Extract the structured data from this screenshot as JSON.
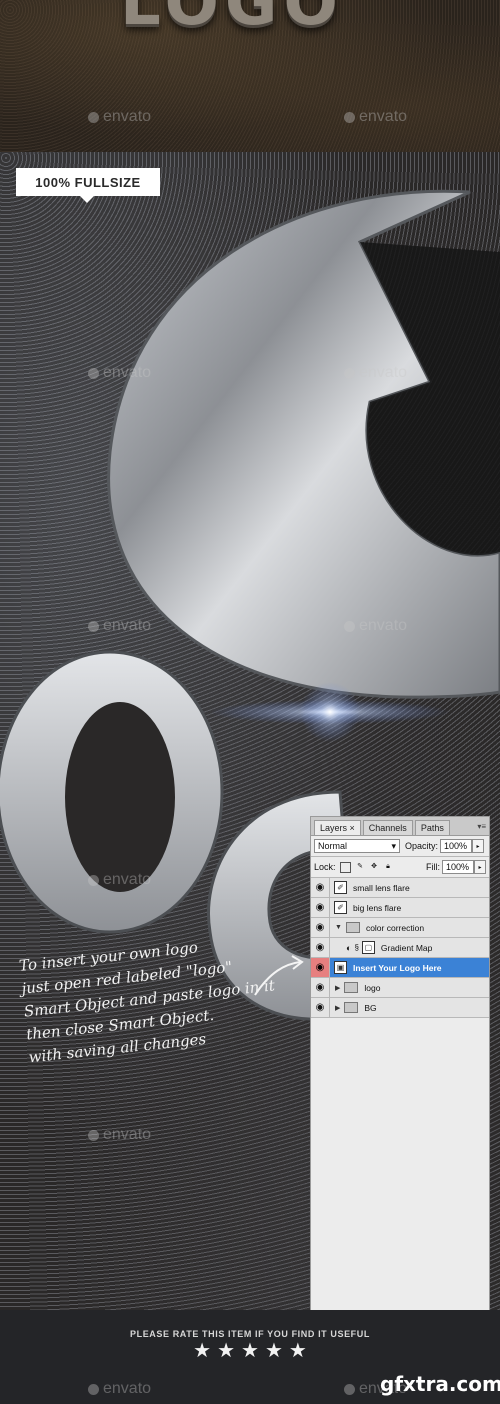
{
  "top_banner": {
    "logo_text": "LOGO",
    "watermark_left": "envato",
    "watermark_right": "envato"
  },
  "badge": {
    "label": "100% FULLSIZE"
  },
  "watermarks": [
    "envato",
    "envato",
    "envato",
    "envato",
    "envato",
    "envato",
    "envato",
    "envato",
    "envato",
    "envato"
  ],
  "scene": {
    "letters": "OGO"
  },
  "handwritten_note": [
    "To insert your own logo",
    "just open red labeled \"logo\"",
    "Smart Object and paste logo in it",
    "then close Smart Object.",
    "with saving all changes"
  ],
  "layers_panel": {
    "tabs": [
      "Layers ×",
      "Channels",
      "Paths"
    ],
    "blend_mode": "Normal",
    "opacity_label": "Opacity:",
    "opacity_value": "100%",
    "lock_label": "Lock:",
    "fill_label": "Fill:",
    "fill_value": "100%",
    "layers": [
      {
        "name": "small lens flare",
        "kind": "layer"
      },
      {
        "name": "big lens flare",
        "kind": "layer"
      },
      {
        "name": "color correction",
        "kind": "group-open"
      },
      {
        "name": "Gradient Map",
        "kind": "adjustment"
      },
      {
        "name": "Insert Your Logo Here",
        "kind": "smart-object",
        "selected": true
      },
      {
        "name": "logo",
        "kind": "group"
      },
      {
        "name": "BG",
        "kind": "group"
      }
    ],
    "selected_color": "#3b82d6",
    "red_label_color": "#e67f7f"
  },
  "footer": {
    "rate_text": "PLEASE RATE THIS ITEM IF YOU FIND IT USEFUL",
    "stars": 5,
    "watermark_left": "envato",
    "watermark_right": "envato",
    "site_watermark": "gfxtra.com"
  }
}
